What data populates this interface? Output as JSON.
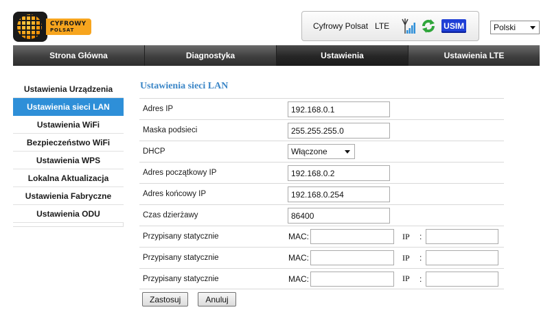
{
  "header": {
    "logo": {
      "line1": "CYFROWY",
      "line2": "POLSAT"
    },
    "status": {
      "operator": "Cyfrowy Polsat",
      "network_type": "LTE",
      "usim_label": "USIM"
    },
    "language": {
      "selected": "Polski"
    }
  },
  "nav": {
    "tabs": [
      {
        "label": "Strona Główna"
      },
      {
        "label": "Diagnostyka"
      },
      {
        "label": "Ustawienia"
      },
      {
        "label": "Ustawienia LTE"
      }
    ]
  },
  "sidebar": {
    "items": [
      {
        "label": "Ustawienia Urządzenia"
      },
      {
        "label": "Ustawienia sieci LAN"
      },
      {
        "label": "Ustawienia WiFi"
      },
      {
        "label": "Bezpieczeństwo WiFi"
      },
      {
        "label": "Ustawienia WPS"
      },
      {
        "label": "Lokalna Aktualizacja"
      },
      {
        "label": "Ustawienia Fabryczne"
      },
      {
        "label": "Ustawienia ODU"
      }
    ]
  },
  "main": {
    "title": "Ustawienia sieci LAN",
    "fields": {
      "ip_address": {
        "label": "Adres IP",
        "value": "192.168.0.1"
      },
      "subnet_mask": {
        "label": "Maska podsieci",
        "value": "255.255.255.0"
      },
      "dhcp": {
        "label": "DHCP",
        "value": "Włączone"
      },
      "start_ip": {
        "label": "Adres początkowy IP",
        "value": "192.168.0.2"
      },
      "end_ip": {
        "label": "Adres końcowy IP",
        "value": "192.168.0.254"
      },
      "lease_time": {
        "label": "Czas dzierżawy",
        "value": "86400"
      }
    },
    "static_entries": [
      {
        "label": "Przypisany statycznie",
        "mac_label": "MAC:",
        "ip_label": "IP",
        "colon": ":",
        "mac": "",
        "ip": ""
      },
      {
        "label": "Przypisany statycznie",
        "mac_label": "MAC:",
        "ip_label": "IP",
        "colon": ":",
        "mac": "",
        "ip": ""
      },
      {
        "label": "Przypisany statycznie",
        "mac_label": "MAC:",
        "ip_label": "IP",
        "colon": ":",
        "mac": "",
        "ip": ""
      }
    ],
    "buttons": {
      "apply": "Zastosuj",
      "cancel": "Anuluj"
    }
  },
  "colors": {
    "accent_blue": "#2e8fd8",
    "title_blue": "#3b86c7",
    "usim_blue": "#1f3fd6",
    "nav_dark": "#3a3a3a",
    "brand_orange": "#f7a51e"
  },
  "icons": {
    "logo": "globe-logo-icon",
    "signal": "antenna-signal-icon",
    "refresh": "refresh-arrows-icon",
    "dropdown": "chevron-down-icon"
  }
}
